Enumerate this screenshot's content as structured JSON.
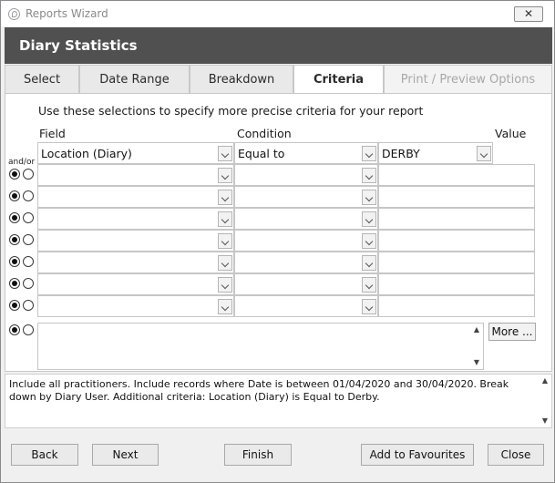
{
  "window": {
    "title": "Reports Wizard",
    "close_label": "✕"
  },
  "header": {
    "title": "Diary Statistics"
  },
  "tabs": [
    {
      "label": "Select",
      "state": "normal"
    },
    {
      "label": "Date Range",
      "state": "normal"
    },
    {
      "label": "Breakdown",
      "state": "normal"
    },
    {
      "label": "Criteria",
      "state": "active"
    },
    {
      "label": "Print / Preview Options",
      "state": "disabled"
    }
  ],
  "criteria": {
    "instructions": "Use these selections to specify more precise criteria for your report",
    "field_header": "Field",
    "condition_header": "Condition",
    "value_header": "Value",
    "andor_label": "and/or",
    "rows": [
      {
        "field": "Location (Diary)",
        "condition": "Equal to",
        "value": "DERBY"
      },
      {
        "field": "",
        "condition": "",
        "value": ""
      },
      {
        "field": "",
        "condition": "",
        "value": ""
      },
      {
        "field": "",
        "condition": "",
        "value": ""
      },
      {
        "field": "",
        "condition": "",
        "value": ""
      },
      {
        "field": "",
        "condition": "",
        "value": ""
      },
      {
        "field": "",
        "condition": "",
        "value": ""
      },
      {
        "field": "",
        "condition": "",
        "value": ""
      }
    ],
    "free_text": "",
    "more_label": "More ..."
  },
  "summary": {
    "text": "Include all practitioners. Include records where Date is between 01/04/2020 and 30/04/2020. Break down by Diary User. Additional criteria: Location (Diary) is Equal to Derby."
  },
  "footer": {
    "back": "Back",
    "next": "Next",
    "finish": "Finish",
    "add_favourites": "Add to Favourites",
    "close": "Close"
  },
  "icons": {
    "app": "app-logo-icon",
    "dropdown": "chevron-down-icon",
    "scroll_up": "scroll-up-icon",
    "scroll_down": "scroll-down-icon"
  }
}
